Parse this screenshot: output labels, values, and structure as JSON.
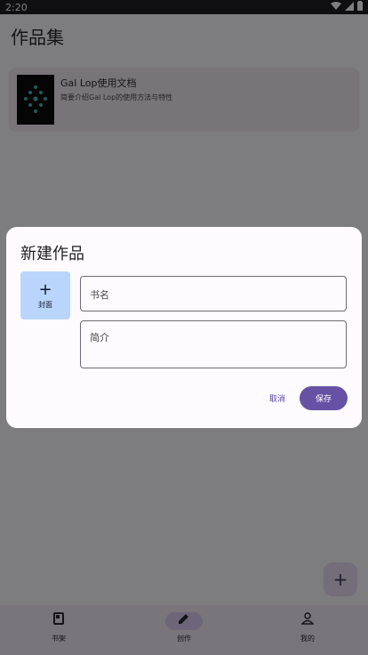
{
  "status_bar": {
    "time": "2:20"
  },
  "page": {
    "title": "作品集"
  },
  "work_card": {
    "title": "Gal Lop使用文档",
    "description": "简要介绍Gal Lop的使用方法与特性"
  },
  "bottom_nav": [
    {
      "label": "书架",
      "icon": "book-icon"
    },
    {
      "label": "创作",
      "icon": "edit-icon"
    },
    {
      "label": "我的",
      "icon": "person-icon"
    }
  ],
  "fab": {
    "icon": "plus-icon"
  },
  "dialog": {
    "title": "新建作品",
    "cover_plus": "+",
    "cover_label": "封面",
    "name_placeholder": "书名",
    "intro_placeholder": "简介",
    "cancel_label": "取消",
    "save_label": "保存"
  }
}
